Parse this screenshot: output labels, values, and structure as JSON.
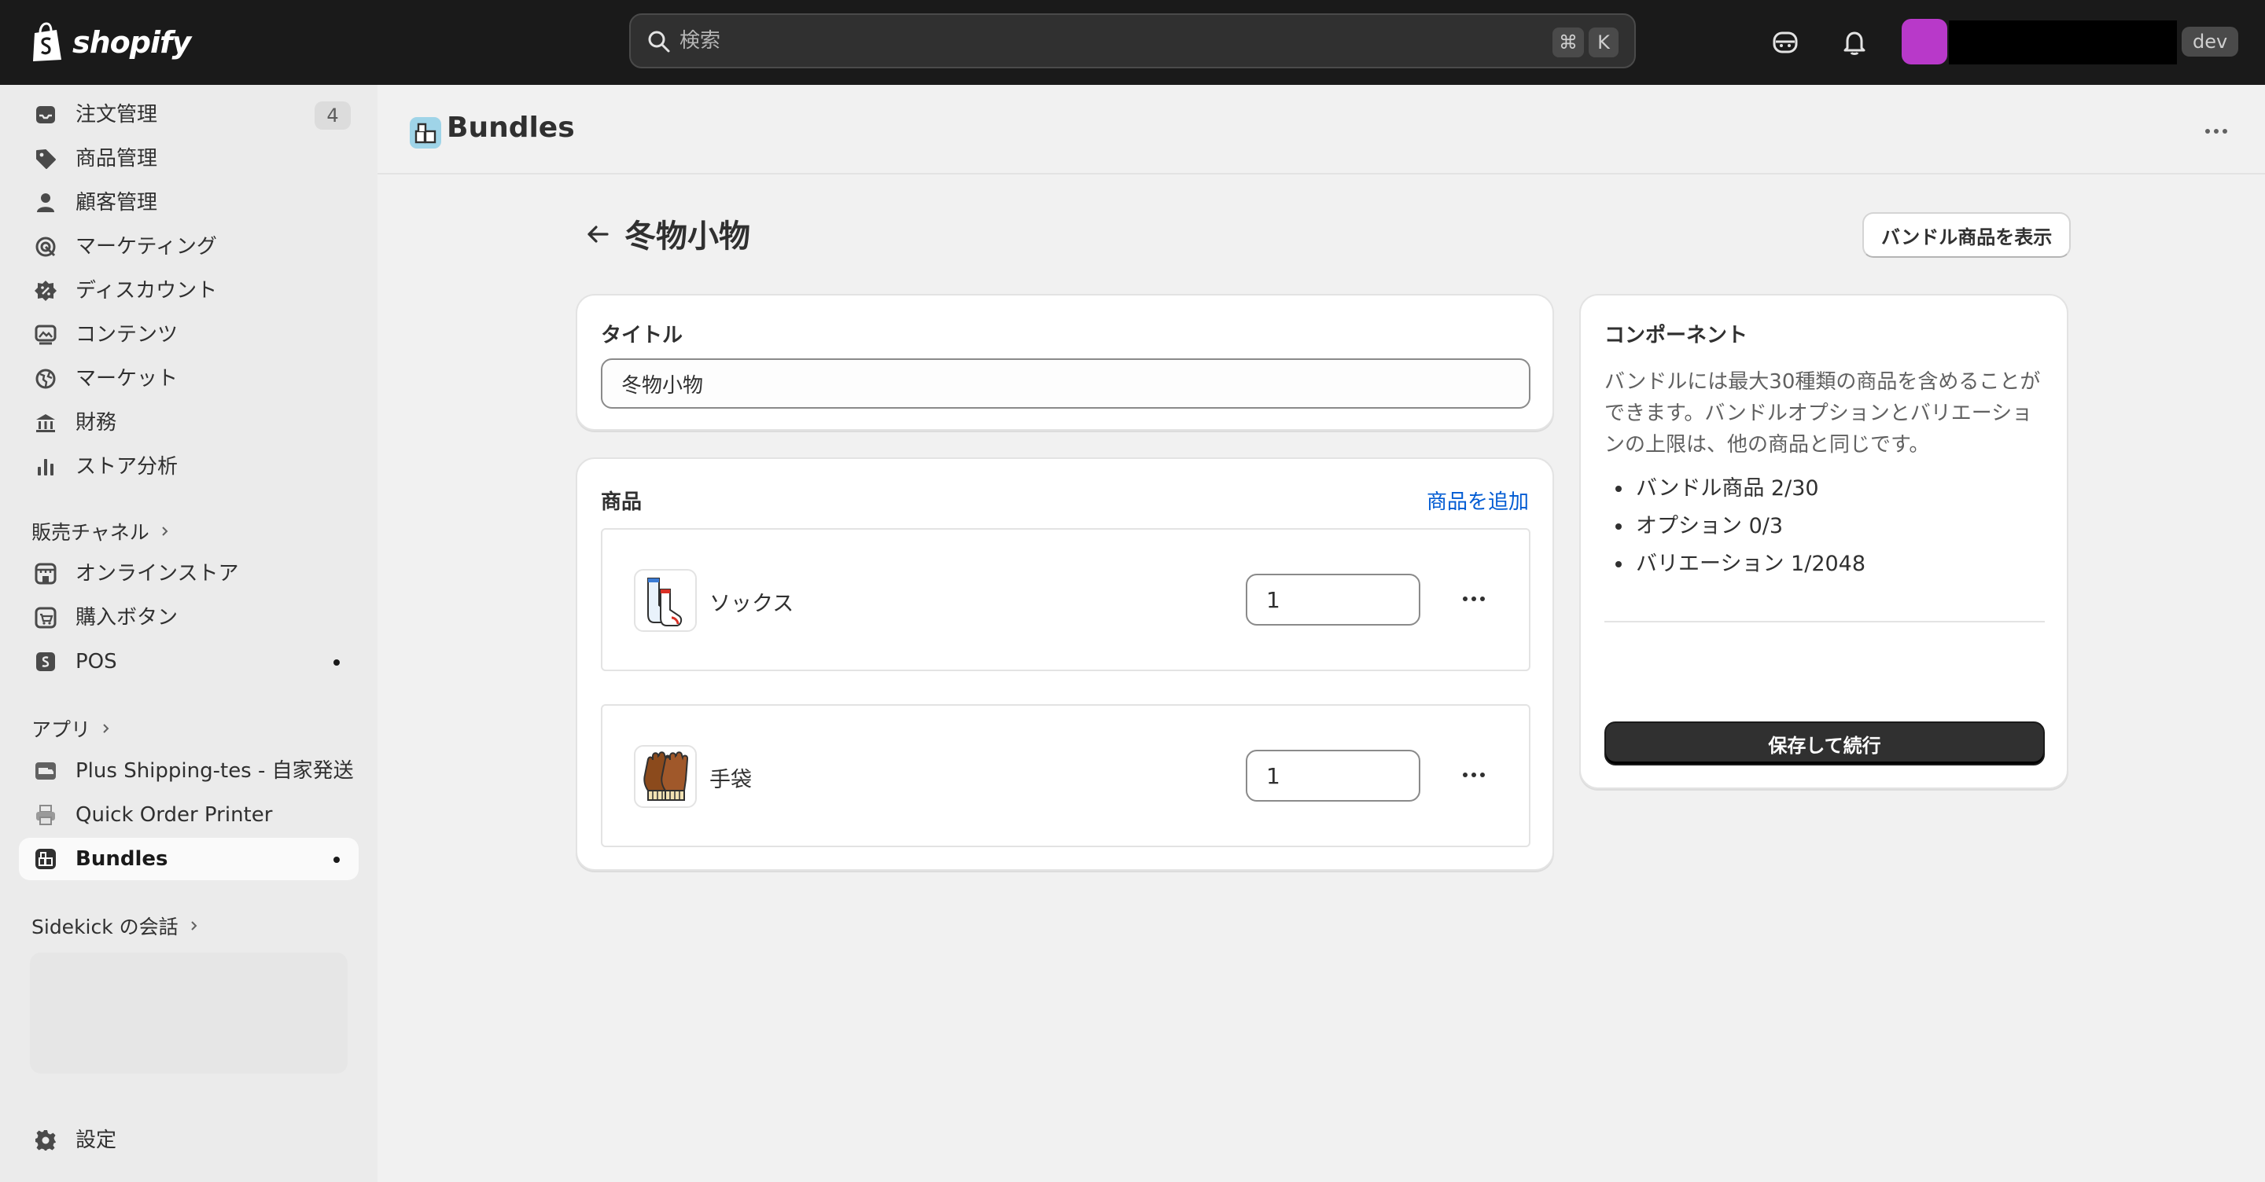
{
  "topbar": {
    "brand": "shopify",
    "search_placeholder": "検索",
    "shortcut_mod": "⌘",
    "shortcut_key": "K",
    "avatar_color": "#b839c9",
    "dev_badge": "dev"
  },
  "sidebar": {
    "main_items": [
      {
        "label": "注文管理",
        "icon": "inbox-icon",
        "badge": "4"
      },
      {
        "label": "商品管理",
        "icon": "tag-icon"
      },
      {
        "label": "顧客管理",
        "icon": "person-icon"
      },
      {
        "label": "マーケティング",
        "icon": "target-icon"
      },
      {
        "label": "ディスカウント",
        "icon": "discount-icon"
      },
      {
        "label": "コンテンツ",
        "icon": "image-icon"
      },
      {
        "label": "マーケット",
        "icon": "globe-icon"
      },
      {
        "label": "財務",
        "icon": "bank-icon"
      },
      {
        "label": "ストア分析",
        "icon": "bar-chart-icon"
      }
    ],
    "sales_channels_header": "販売チャネル",
    "sales_channels": [
      {
        "label": "オンラインストア",
        "icon": "storefront-icon"
      },
      {
        "label": "購入ボタン",
        "icon": "buy-button-icon"
      },
      {
        "label": "POS",
        "icon": "pos-icon"
      }
    ],
    "apps_header": "アプリ",
    "apps": [
      {
        "label": "Plus Shipping-tes - 自家発送",
        "icon": "shipping-app-icon"
      },
      {
        "label": "Quick Order Printer",
        "icon": "printer-icon"
      },
      {
        "label": "Bundles",
        "icon": "bundles-icon"
      }
    ],
    "sidekick_header": "Sidekick の会話",
    "settings_label": "設定"
  },
  "app": {
    "name": "Bundles"
  },
  "page": {
    "title": "冬物小物",
    "view_button": "バンドル商品を表示"
  },
  "title_card": {
    "label": "タイトル",
    "value": "冬物小物"
  },
  "products_card": {
    "label": "商品",
    "add_link": "商品を追加",
    "items": [
      {
        "name": "ソックス",
        "quantity": "1"
      },
      {
        "name": "手袋",
        "quantity": "1"
      }
    ]
  },
  "components_card": {
    "title": "コンポーネント",
    "description": "バンドルには最大30種類の商品を含めることができます。バンドルオプションとバリエーションの上限は、他の商品と同じです。",
    "stats": [
      "バンドル商品 2/30",
      "オプション 0/3",
      "バリエーション 1/2048"
    ],
    "save_button": "保存して続行"
  },
  "colors": {
    "topbar": "#1a1a1a",
    "sidebar": "#ebebeb",
    "background": "#f1f1f1",
    "link": "#005bd3",
    "primary_button": "#303030"
  }
}
